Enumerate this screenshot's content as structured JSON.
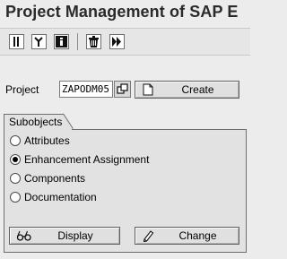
{
  "window": {
    "title": "Project Management of SAP E"
  },
  "toolbar": {
    "buttons": [
      {
        "name": "display-icon"
      },
      {
        "name": "where-used-icon"
      },
      {
        "name": "info-icon"
      },
      {
        "name": "delete-icon"
      },
      {
        "name": "execute-icon"
      }
    ]
  },
  "project": {
    "label": "Project",
    "value": "ZAPODM05",
    "create_label": "Create"
  },
  "subobjects": {
    "title": "Subobjects",
    "options": [
      {
        "label": "Attributes",
        "selected": false
      },
      {
        "label": "Enhancement Assignment",
        "selected": true
      },
      {
        "label": "Components",
        "selected": false
      },
      {
        "label": "Documentation",
        "selected": false
      }
    ],
    "display_label": "Display",
    "change_label": "Change"
  }
}
